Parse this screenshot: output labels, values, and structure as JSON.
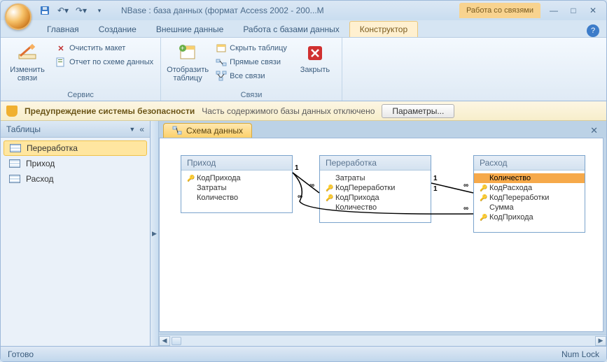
{
  "title": "NBase : база данных (формат Access 2002 - 200...M",
  "context_tab_group": "Работа со связями",
  "tabs": {
    "home": "Главная",
    "create": "Создание",
    "external": "Внешние данные",
    "dbtools": "Работа с базами данных",
    "design": "Конструктор"
  },
  "ribbon": {
    "group_service": "Сервис",
    "group_links": "Связи",
    "edit_links": "Изменить связи",
    "clear_layout": "Очистить макет",
    "schema_report": "Отчет по схеме данных",
    "show_table": "Отобразить таблицу",
    "hide_table": "Скрыть таблицу",
    "direct_links": "Прямые связи",
    "all_links": "Все связи",
    "close": "Закрыть"
  },
  "security": {
    "title": "Предупреждение системы безопасности",
    "msg": "Часть содержимого базы данных отключено",
    "btn": "Параметры..."
  },
  "nav": {
    "header": "Таблицы",
    "items": [
      "Переработка",
      "Приход",
      "Расход"
    ]
  },
  "workspace": {
    "tab": "Схема данных"
  },
  "entities": {
    "prihod": {
      "title": "Приход",
      "fields": [
        {
          "key": true,
          "name": "КодПрихода"
        },
        {
          "key": false,
          "name": "Затраты"
        },
        {
          "key": false,
          "name": "Количество"
        }
      ]
    },
    "pererabotka": {
      "title": "Переработка",
      "fields": [
        {
          "key": false,
          "name": "Затраты"
        },
        {
          "key": true,
          "name": "КодПереработки"
        },
        {
          "key": true,
          "name": "КодПрихода"
        },
        {
          "key": false,
          "name": "Количество"
        }
      ]
    },
    "rashod": {
      "title": "Расход",
      "fields": [
        {
          "key": false,
          "name": "Количество",
          "hl": true
        },
        {
          "key": true,
          "name": "КодРасхода"
        },
        {
          "key": true,
          "name": "КодПереработки"
        },
        {
          "key": false,
          "name": "Сумма"
        },
        {
          "key": true,
          "name": "КодПрихода"
        }
      ]
    }
  },
  "relations": {
    "one": "1",
    "many": "∞"
  },
  "status": {
    "ready": "Готово",
    "numlock": "Num Lock"
  }
}
